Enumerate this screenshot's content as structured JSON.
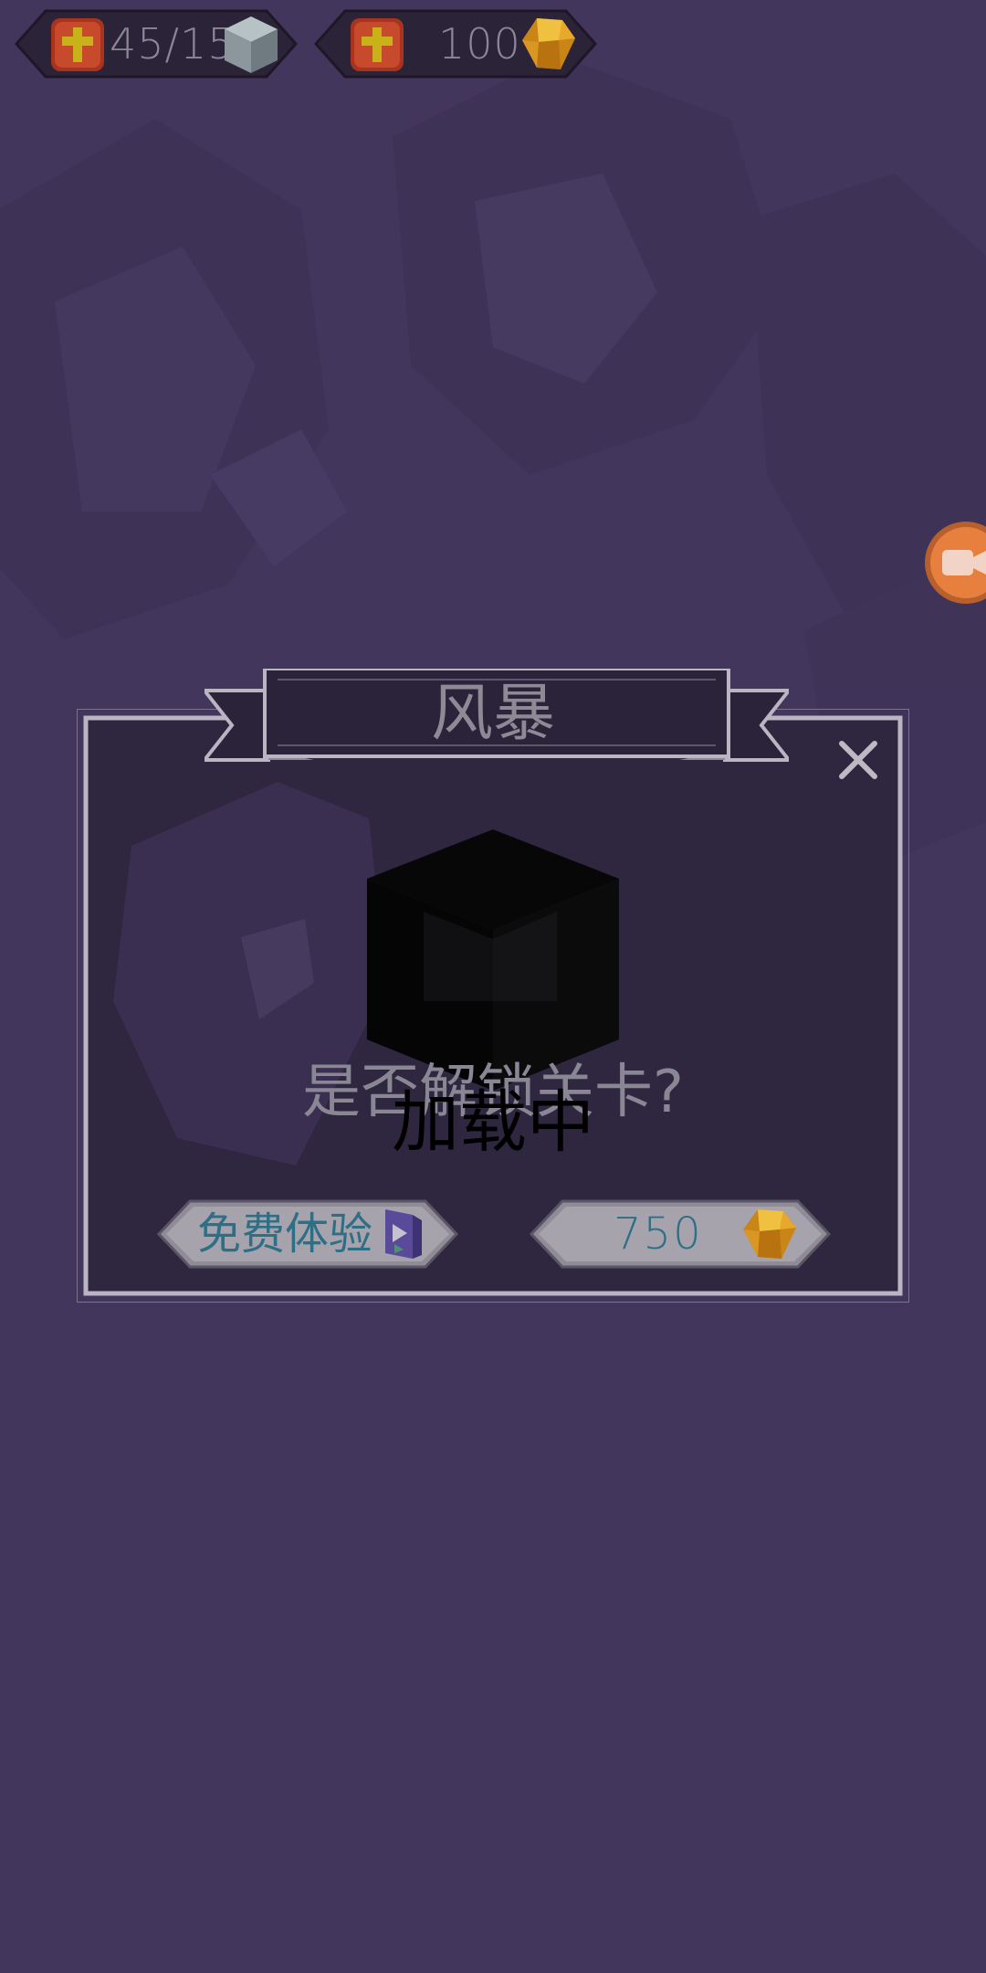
{
  "top_bar": {
    "blocks_counter": {
      "value": "45/15",
      "plus_icon": "plus-icon",
      "resource_icon": "silver-cube-icon"
    },
    "gems_counter": {
      "value": "100",
      "plus_icon": "plus-icon",
      "resource_icon": "gold-gem-icon"
    }
  },
  "side": {
    "video_button_icon": "video-camera-icon"
  },
  "dialog": {
    "title": "风暴",
    "question": "是否解锁关卡?",
    "loading": "加载中",
    "free_trial_button": {
      "label": "免费体验",
      "icon": "video-ad-icon"
    },
    "unlock_button": {
      "cost": "750",
      "icon": "gold-gem-icon"
    },
    "close_icon": "close-icon"
  },
  "colors": {
    "background": "#43365d",
    "panel": "#2f2640",
    "frame": "#b9b5c2",
    "button_fill": "#a6a3ad",
    "button_text": "#2f6f86",
    "plus_badge": "#c74a2c",
    "gem": "#e0a023",
    "video_button": "#e77f3e"
  }
}
